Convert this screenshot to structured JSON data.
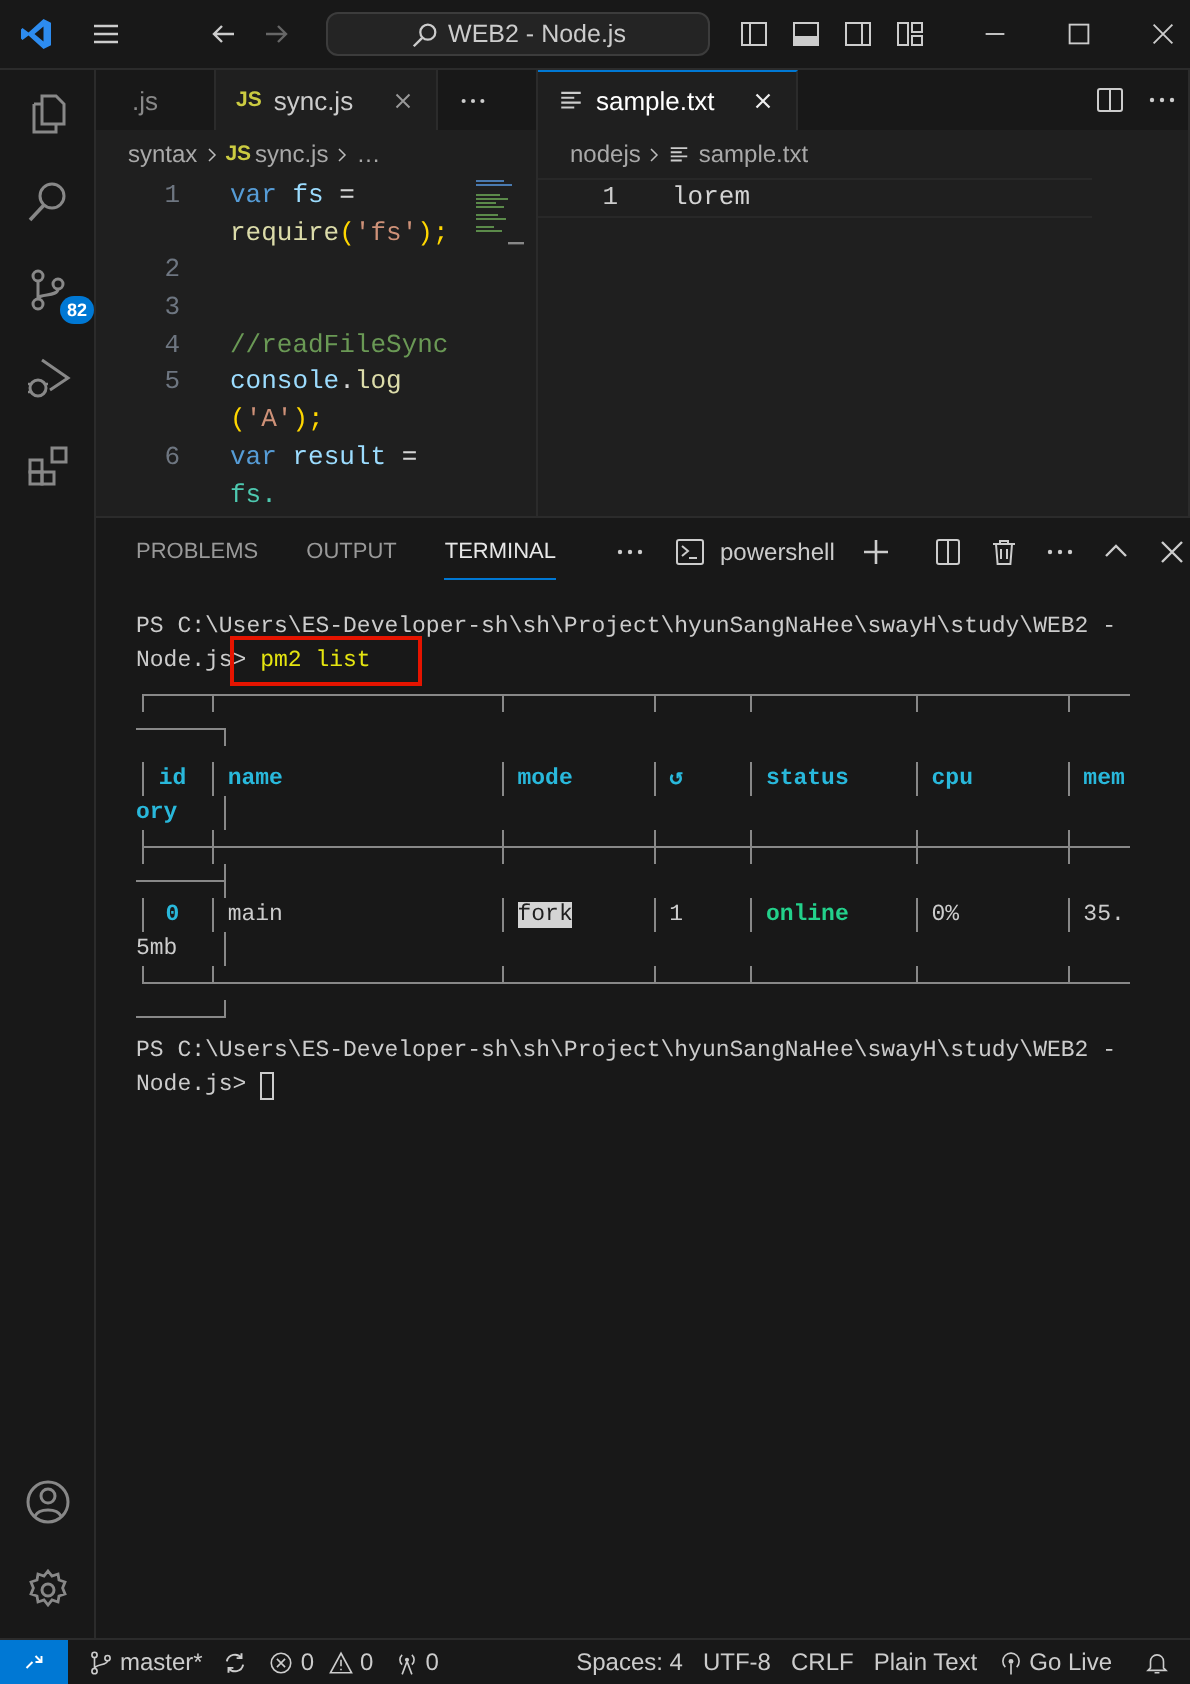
{
  "window": {
    "title": "WEB2 - Node.js"
  },
  "activity_bar": {
    "source_control_badge": "82"
  },
  "editor_left": {
    "tabs": [
      {
        "label": ".js",
        "kind": "partial",
        "selected": false
      },
      {
        "label": "sync.js",
        "kind": "js",
        "icon": "JS",
        "selected": true
      }
    ],
    "breadcrumb": [
      {
        "text": "syntax"
      },
      {
        "text": "sync.js",
        "icon": "JS"
      },
      {
        "text": "…"
      }
    ],
    "lines": [
      {
        "number": "1",
        "tokens": [
          {
            "text": "var ",
            "kind": "keyword"
          },
          {
            "text": "fs",
            "kind": "variable"
          },
          {
            "text": " =",
            "kind": "plain"
          }
        ]
      },
      {
        "tokens": [
          {
            "text": "require",
            "kind": "function"
          },
          {
            "text": "(",
            "kind": "bracket"
          },
          {
            "text": "'fs'",
            "kind": "string"
          },
          {
            "text": ");",
            "kind": "bracket"
          }
        ]
      },
      {
        "number": "2"
      },
      {
        "number": "3"
      },
      {
        "number": "4",
        "tokens": [
          {
            "text": "//readFileSync",
            "kind": "comment"
          }
        ]
      },
      {
        "number": "5",
        "tokens": [
          {
            "text": "console",
            "kind": "variable"
          },
          {
            "text": ".",
            "kind": "plain"
          },
          {
            "text": "log",
            "kind": "function"
          }
        ]
      },
      {
        "tokens": [
          {
            "text": "(",
            "kind": "bracket"
          },
          {
            "text": "'A'",
            "kind": "string"
          },
          {
            "text": ");",
            "kind": "bracket"
          }
        ]
      },
      {
        "number": "6",
        "tokens": [
          {
            "text": "var ",
            "kind": "keyword"
          },
          {
            "text": "result",
            "kind": "variable"
          },
          {
            "text": " =",
            "kind": "plain"
          }
        ]
      },
      {
        "tokens": [
          {
            "text": "fs.",
            "kind": "type"
          }
        ]
      }
    ]
  },
  "editor_right": {
    "tabs": [
      {
        "label": "sample.txt",
        "kind": "text",
        "selected": true
      }
    ],
    "breadcrumb": [
      {
        "text": "nodejs"
      },
      {
        "text": "sample.txt",
        "kind": "text"
      }
    ],
    "lines": [
      {
        "number": "1",
        "text": "lorem"
      }
    ]
  },
  "panel": {
    "tabs": [
      {
        "label": "PROBLEMS",
        "selected": false
      },
      {
        "label": "OUTPUT",
        "selected": false
      },
      {
        "label": "TERMINAL",
        "selected": true
      }
    ],
    "terminal_name": "powershell"
  },
  "terminal": {
    "prompt": [
      "PS C:\\Users\\ES-Developer-sh\\sh\\Project\\hyunSangNaHee\\swayH\\study\\WEB2 -",
      "Node.js>"
    ],
    "command": "pm2 list",
    "command_marked": true,
    "table": {
      "columns": [
        {
          "label": "id"
        },
        {
          "label": "name"
        },
        {
          "label": "mode"
        },
        {
          "label": "↺"
        },
        {
          "label": "status"
        },
        {
          "label": "cpu"
        },
        {
          "label": "mem",
          "wrap": "ory"
        }
      ],
      "rows": [
        {
          "cells": [
            {
              "text": "0",
              "kind": "id",
              "highlighted": false
            },
            {
              "text": "main",
              "kind": "plain",
              "highlighted": false
            },
            {
              "text": "fork",
              "kind": "plain",
              "highlighted": true
            },
            {
              "text": "1",
              "kind": "plain",
              "highlighted": false
            },
            {
              "text": "online",
              "kind": "status",
              "highlighted": false
            },
            {
              "text": "0%",
              "kind": "plain",
              "highlighted": false
            },
            {
              "text": "35.",
              "kind": "plain",
              "highlighted": false,
              "wrap": "5mb"
            }
          ]
        }
      ]
    },
    "final_prompt": [
      "PS C:\\Users\\ES-Developer-sh\\sh\\Project\\hyunSangNaHee\\swayH\\study\\WEB2 -",
      "Node.js>"
    ]
  },
  "status_bar": {
    "branch": "master*",
    "errors": "0",
    "warnings": "0",
    "ports": "0",
    "right": [
      "Spaces: 4",
      "UTF-8",
      "CRLF",
      "Plain Text"
    ],
    "go_live": "Go Live"
  }
}
